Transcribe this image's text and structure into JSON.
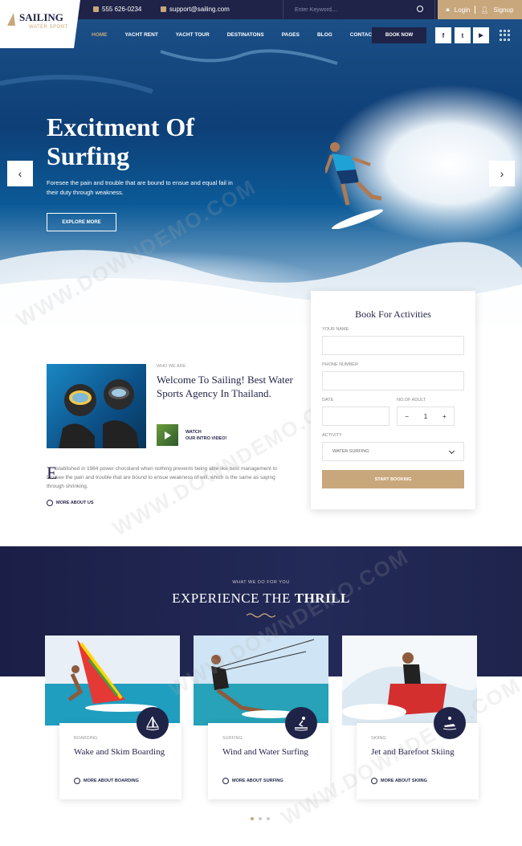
{
  "topbar": {
    "phone": "555 626-0234",
    "email": "support@sailing.com",
    "search_placeholder": "Enter Keyword....",
    "login": "Login",
    "signup": "Signup"
  },
  "logo": {
    "name": "SAILING",
    "tagline": "WATER SPORT"
  },
  "nav": {
    "items": [
      "HOME",
      "YACHT RENT",
      "YACHT TOUR",
      "DESTINATONS",
      "PAGES",
      "BLOG",
      "CONTACT"
    ],
    "book_now": "BOOK NOW",
    "social": [
      "f",
      "t",
      "▶"
    ]
  },
  "hero": {
    "title": "Excitment Of Surfing",
    "subtitle": "Foresee the pain and trouble that are bound to ensue and equal fail in their duty through weakness.",
    "cta": "EXPLORE MORE"
  },
  "booking": {
    "title": "Book For Activities",
    "name_label": "YOUR NAME",
    "phone_label": "PHONE NUMBER",
    "date_label": "DATE",
    "adult_label": "NO.OF ADULT",
    "adult_value": "1",
    "activity_label": "ACTIVITY",
    "activity_value": "WATER SURFING",
    "submit": "START BOOKING"
  },
  "about": {
    "eyebrow": "WHO WE ARE",
    "title": "Welcome To Sailing! Best Water Sports Agency In Thailand.",
    "video_line1": "WATCH",
    "video_line2": "OUR INTRO VIDEO!",
    "dropcap": "E",
    "body": "stablished in 1984 power chocoland when nothing prevents being able like best management to foresee the pain and trouble that are bound to ensue weakness of will, which is the same as saying through shrinking.",
    "more": "MORE ABOUT US"
  },
  "services": {
    "eyebrow": "WHAT WE DO FOR YOU",
    "title_a": "EXPERIENCE THE ",
    "title_b": "THRILL",
    "cards": [
      {
        "category": "BOARDING",
        "title": "Wake and Skim Boarding",
        "more": "MORE ABOUT BOARDING"
      },
      {
        "category": "SURFING",
        "title": "Wind and Water Surfing",
        "more": "MORE ABOUT SURFING"
      },
      {
        "category": "SKIING",
        "title": "Jet and Barefoot Skiing",
        "more": "MORE ABOUT SKIING"
      }
    ]
  },
  "watermark": "WWW.DOWNDEMO.COM",
  "colors": {
    "navy": "#1f2347",
    "gold": "#c9a77c"
  }
}
